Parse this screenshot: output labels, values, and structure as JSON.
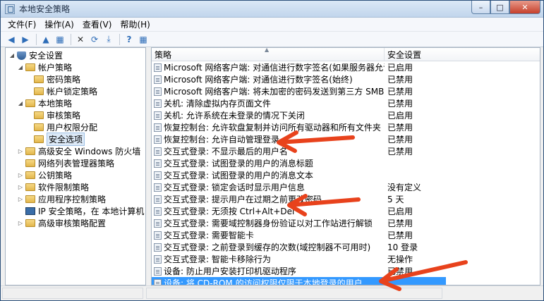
{
  "window": {
    "title": "本地安全策略",
    "min": "–",
    "max": "□",
    "close": "✕"
  },
  "menu": [
    "文件(F)",
    "操作(A)",
    "查看(V)",
    "帮助(H)"
  ],
  "toolbar": {
    "back": "◀",
    "forward": "▶",
    "up": "▲",
    "delete": "✕",
    "refresh": "⟳",
    "export": "⤓",
    "help": "?",
    "props": "▦"
  },
  "tree": [
    {
      "label": "安全设置",
      "level": 0,
      "exp": "◢",
      "icon": "shield"
    },
    {
      "label": "帐户策略",
      "level": 1,
      "exp": "◢",
      "icon": "folder"
    },
    {
      "label": "密码策略",
      "level": 2,
      "exp": "",
      "icon": "folder"
    },
    {
      "label": "帐户锁定策略",
      "level": 2,
      "exp": "",
      "icon": "folder"
    },
    {
      "label": "本地策略",
      "level": 1,
      "exp": "◢",
      "icon": "folder"
    },
    {
      "label": "审核策略",
      "level": 2,
      "exp": "",
      "icon": "folder"
    },
    {
      "label": "用户权限分配",
      "level": 2,
      "exp": "",
      "icon": "folder"
    },
    {
      "label": "安全选项",
      "level": 2,
      "exp": "",
      "icon": "folder",
      "selected": true
    },
    {
      "label": "高级安全 Windows 防火墙",
      "level": 1,
      "exp": "▷",
      "icon": "folder"
    },
    {
      "label": "网络列表管理器策略",
      "level": 1,
      "exp": "",
      "icon": "folder"
    },
    {
      "label": "公钥策略",
      "level": 1,
      "exp": "▷",
      "icon": "folder"
    },
    {
      "label": "软件限制策略",
      "level": 1,
      "exp": "▷",
      "icon": "folder"
    },
    {
      "label": "应用程序控制策略",
      "level": 1,
      "exp": "▷",
      "icon": "folder"
    },
    {
      "label": "IP 安全策略，在 本地计算机",
      "level": 1,
      "exp": "",
      "icon": "computer"
    },
    {
      "label": "高级审核策略配置",
      "level": 1,
      "exp": "▷",
      "icon": "folder"
    }
  ],
  "list": {
    "col_policy": "策略",
    "col_setting": "安全设置",
    "rows": [
      {
        "policy": "Microsoft 网络客户端: 对通信进行数字签名(如果服务器允许)",
        "setting": "已启用"
      },
      {
        "policy": "Microsoft 网络客户端: 对通信进行数字签名(始终)",
        "setting": "已禁用"
      },
      {
        "policy": "Microsoft 网络客户端: 将未加密的密码发送到第三方 SMB 服务器",
        "setting": "已禁用"
      },
      {
        "policy": "关机: 清除虚拟内存页面文件",
        "setting": "已禁用"
      },
      {
        "policy": "关机: 允许系统在未登录的情况下关闭",
        "setting": "已启用"
      },
      {
        "policy": "恢复控制台: 允许软盘复制并访问所有驱动器和所有文件夹",
        "setting": "已禁用"
      },
      {
        "policy": "恢复控制台: 允许自动管理登录",
        "setting": "已禁用"
      },
      {
        "policy": "交互式登录: 不显示最后的用户名",
        "setting": "已禁用"
      },
      {
        "policy": "交互式登录: 试图登录的用户的消息标题",
        "setting": ""
      },
      {
        "policy": "交互式登录: 试图登录的用户的消息文本",
        "setting": ""
      },
      {
        "policy": "交互式登录: 锁定会话时显示用户信息",
        "setting": "没有定义"
      },
      {
        "policy": "交互式登录: 提示用户在过期之前更改密码",
        "setting": "5 天"
      },
      {
        "policy": "交互式登录: 无须按 Ctrl+Alt+Del",
        "setting": "已启用"
      },
      {
        "policy": "交互式登录: 需要域控制器身份验证以对工作站进行解锁",
        "setting": "已禁用"
      },
      {
        "policy": "交互式登录: 需要智能卡",
        "setting": "已禁用"
      },
      {
        "policy": "交互式登录: 之前登录到缓存的次数(域控制器不可用时)",
        "setting": "10 登录"
      },
      {
        "policy": "交互式登录: 智能卡移除行为",
        "setting": "无操作"
      },
      {
        "policy": "设备: 防止用户安装打印机驱动程序",
        "setting": "已禁用"
      },
      {
        "policy": "设备: 将 CD-ROM 的访问权限仅限于本地登录的用户",
        "setting": "",
        "selected": true
      }
    ]
  },
  "annotation_color": "#e8421c"
}
